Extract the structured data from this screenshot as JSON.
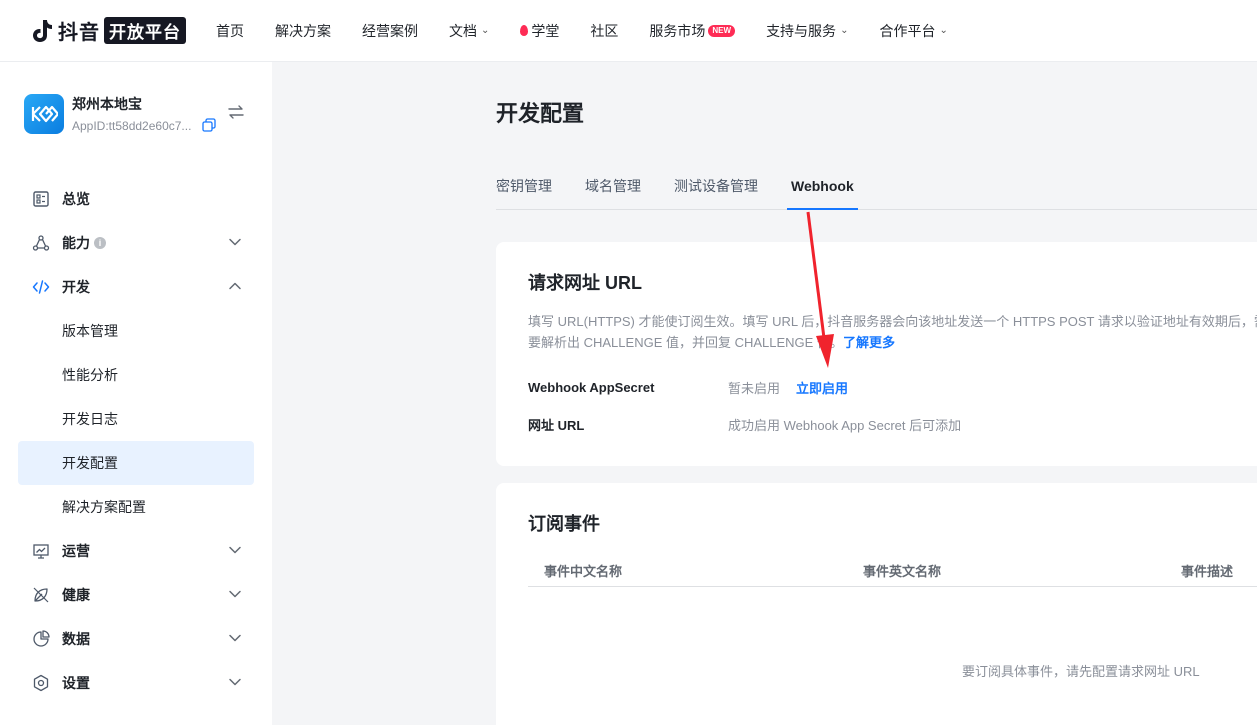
{
  "nav": {
    "logo_text": "抖音",
    "logo_badge": "开放平台",
    "items": [
      {
        "label": "首页"
      },
      {
        "label": "解决方案"
      },
      {
        "label": "经营案例"
      },
      {
        "label": "文档",
        "chevron": true
      },
      {
        "label": "学堂",
        "flame": true
      },
      {
        "label": "社区"
      },
      {
        "label": "服务市场",
        "badge": "NEW"
      },
      {
        "label": "支持与服务",
        "chevron": true
      },
      {
        "label": "合作平台",
        "chevron": true
      }
    ]
  },
  "app": {
    "name": "郑州本地宝",
    "app_id": "AppID:tt58dd2e60c7..."
  },
  "sidebar": {
    "items": [
      {
        "label": "总览",
        "icon": "dashboard-icon"
      },
      {
        "label": "能力",
        "icon": "capability-icon",
        "info": "i",
        "arrow": "down"
      },
      {
        "label": "开发",
        "icon": "code-icon",
        "arrow": "up"
      },
      {
        "label": "版本管理",
        "sub": true
      },
      {
        "label": "性能分析",
        "sub": true
      },
      {
        "label": "开发日志",
        "sub": true
      },
      {
        "label": "开发配置",
        "sub": true,
        "active": true
      },
      {
        "label": "解决方案配置",
        "sub": true
      },
      {
        "label": "运营",
        "icon": "operation-icon",
        "arrow": "down"
      },
      {
        "label": "健康",
        "icon": "health-icon",
        "arrow": "down"
      },
      {
        "label": "数据",
        "icon": "pie-chart-icon",
        "arrow": "down"
      },
      {
        "label": "设置",
        "icon": "settings-icon",
        "arrow": "down"
      }
    ]
  },
  "main": {
    "title": "开发配置",
    "tabs": [
      {
        "label": "密钥管理"
      },
      {
        "label": "域名管理"
      },
      {
        "label": "测试设备管理"
      },
      {
        "label": "Webhook",
        "active": true
      }
    ],
    "request_url": {
      "title": "请求网址 URL",
      "desc": "填写 URL(HTTPS) 才能使订阅生效。填写 URL 后，抖音服务器会向该地址发送一个 HTTPS POST 请求以验证地址有效期后，需要解析出 CHALLENGE 值，并回复 CHALLENGE 值。",
      "learn_more": "了解更多",
      "secret_label": "Webhook AppSecret",
      "secret_status": "暂未启用",
      "secret_action": "立即启用",
      "url_label": "网址 URL",
      "url_hint": "成功启用 Webhook App Secret 后可添加"
    },
    "events": {
      "title": "订阅事件",
      "columns": [
        "事件中文名称",
        "事件英文名称",
        "事件描述"
      ],
      "empty": "要订阅具体事件，请先配置请求网址 URL"
    }
  },
  "colors": {
    "accent": "#1677ff",
    "annotation_arrow": "#f0232d",
    "active_bg": "#e8f2ff"
  }
}
